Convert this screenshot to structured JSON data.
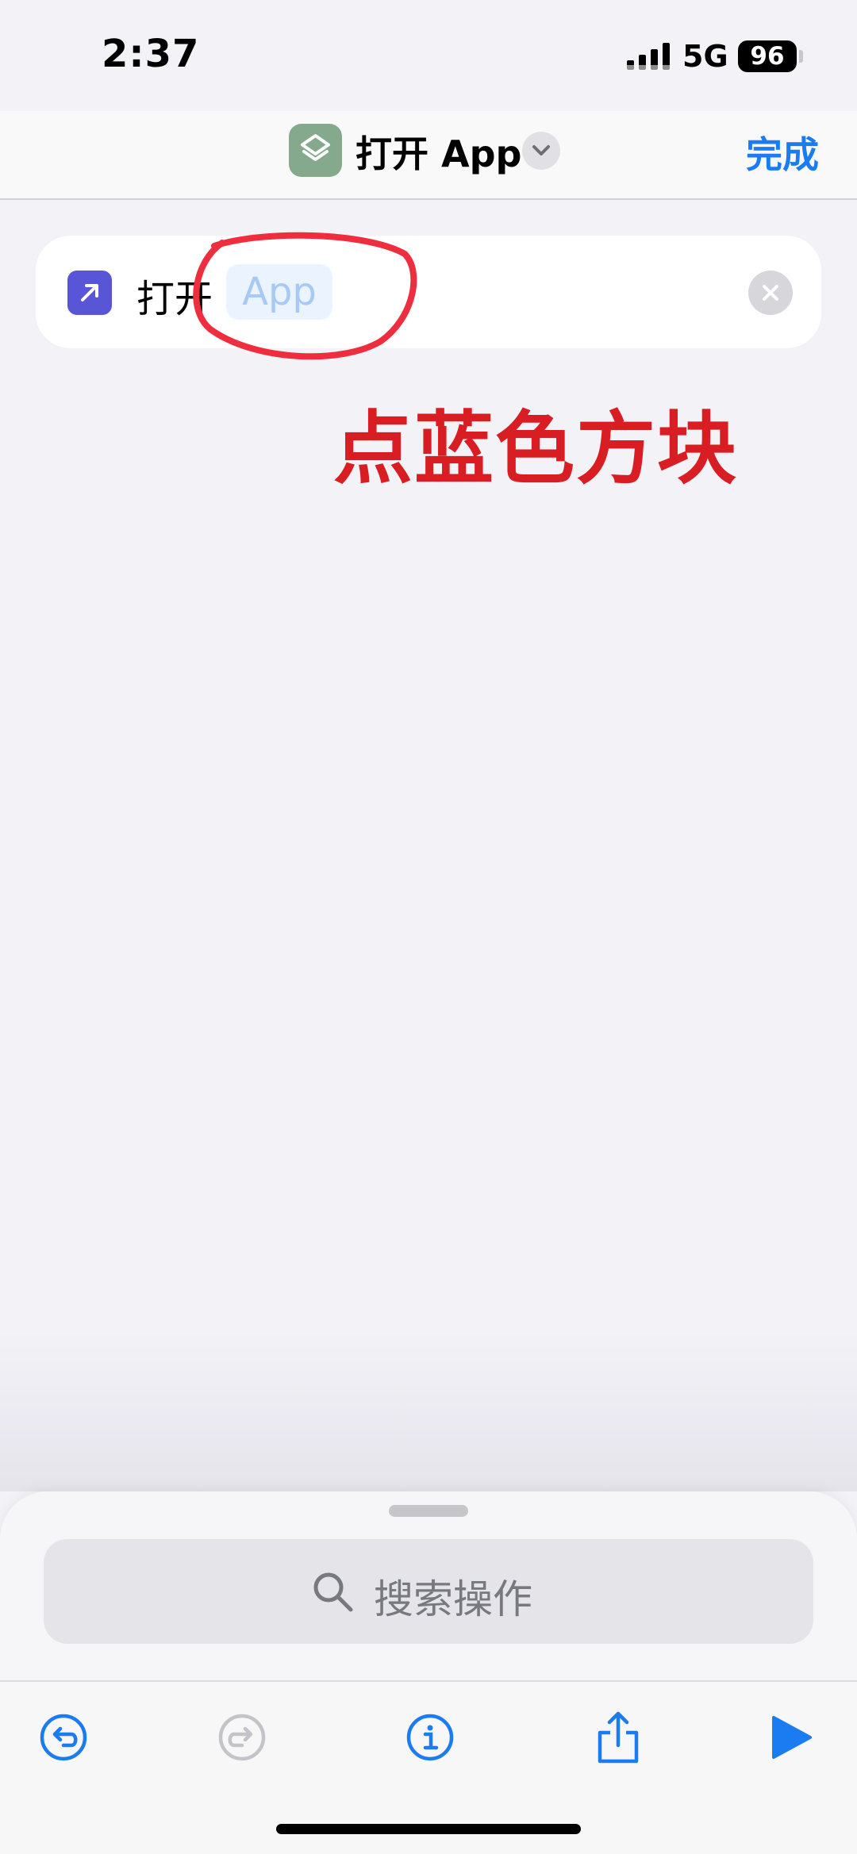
{
  "status_bar": {
    "time": "2:37",
    "network": "5G",
    "battery": "96"
  },
  "nav": {
    "title": "打开 App",
    "done_label": "完成"
  },
  "action": {
    "verb": "打开",
    "param_placeholder": "App"
  },
  "annotation": {
    "text": "点蓝色方块",
    "color": "#d81e22"
  },
  "search": {
    "placeholder": "搜索操作"
  },
  "icons": {
    "shortcut": "shortcuts-layers-icon",
    "action": "open-app-arrow-icon",
    "clear": "close-circle-icon",
    "chevron": "chevron-down-icon",
    "search": "search-icon",
    "toolbar": [
      "undo-icon",
      "redo-icon",
      "info-icon",
      "share-icon",
      "play-icon"
    ]
  },
  "colors": {
    "accent": "#1a7cf0",
    "action_icon_bg": "#5856d6",
    "shortcut_icon_bg": "#84a98c",
    "disabled": "#c3c3c8"
  }
}
